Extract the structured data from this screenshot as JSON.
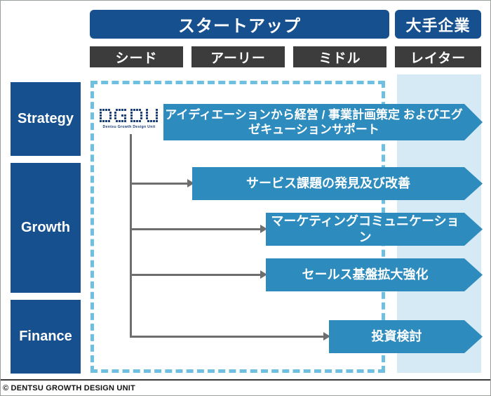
{
  "header": {
    "stages": [
      {
        "id": "startup",
        "label": "スタートアップ"
      },
      {
        "id": "enterprise",
        "label": "大手企業"
      }
    ],
    "phases": [
      {
        "label": "シード"
      },
      {
        "label": "アーリー"
      },
      {
        "label": "ミドル"
      },
      {
        "label": "レイター"
      }
    ]
  },
  "categories": [
    {
      "label": "Strategy"
    },
    {
      "label": "Growth"
    },
    {
      "label": "Finance"
    }
  ],
  "services": [
    {
      "label": "アイディエーションから経営 / 事業計画策定\nおよびエグゼキューションサポート"
    },
    {
      "label": "サービス課題の発見及び改善"
    },
    {
      "label": "マーケティングコミュニケーション"
    },
    {
      "label": "セールス基盤拡大強化"
    },
    {
      "label": "投資検討"
    }
  ],
  "logo": {
    "mark_letters": "DGDU",
    "words": "Dentsu  Growth  Design  Unit"
  },
  "footer": {
    "copyright": "© DENTSU GROWTH DESIGN UNIT"
  },
  "colors": {
    "brand_navy": "#17508f",
    "service_teal": "#2d8bbd",
    "scope_dash": "#6fc0e0",
    "enterprise_band": "#d6eaf6",
    "phase_tab": "#3c3c3c",
    "connector": "#6e6e6e"
  }
}
